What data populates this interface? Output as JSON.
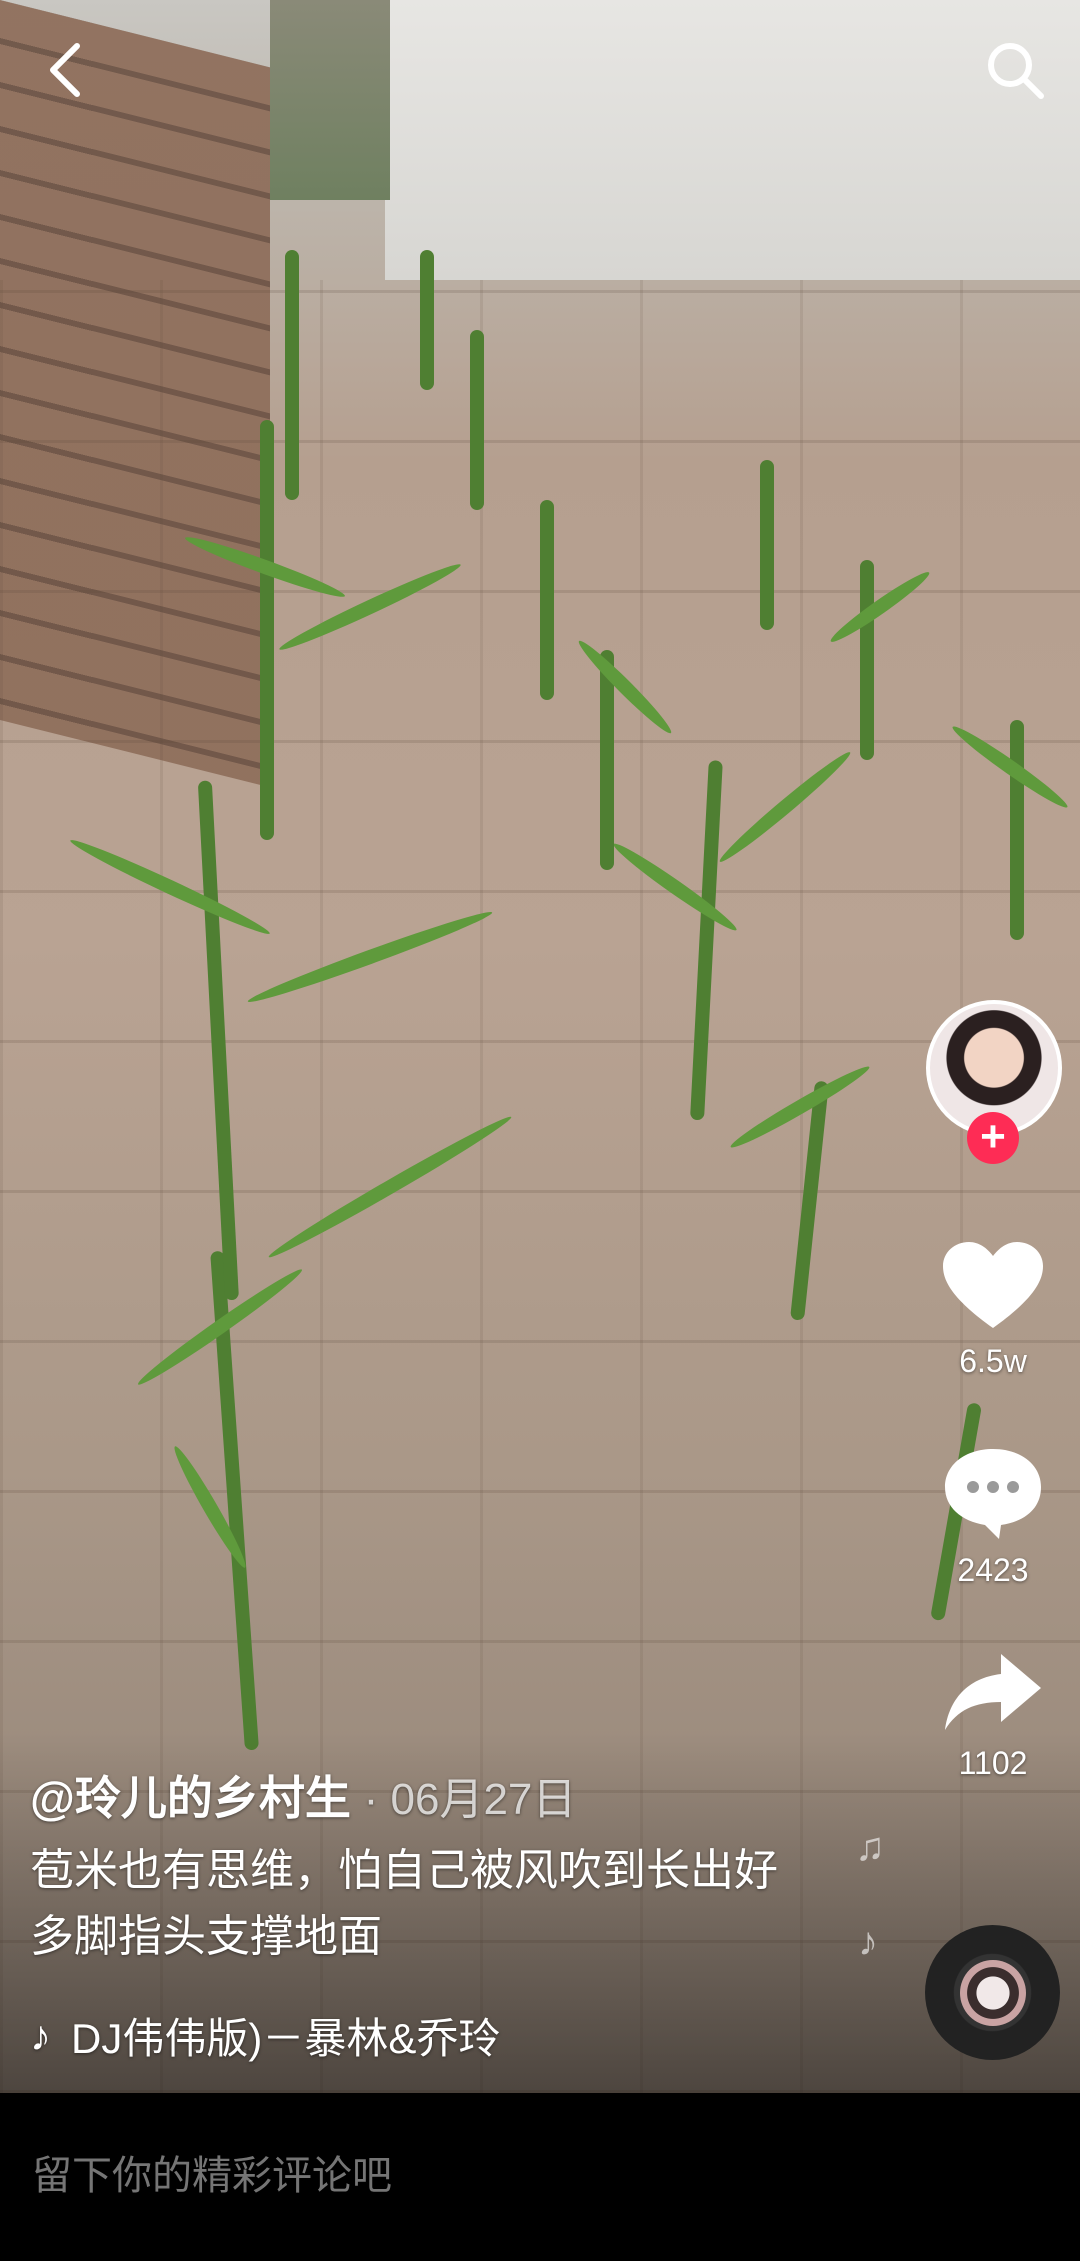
{
  "author": {
    "handle": "@玲儿的乡村生",
    "date": "· 06月27日"
  },
  "caption": {
    "text": "苞米也有思维，怕自己被风吹到长出好多脚指头支撑地面"
  },
  "music": {
    "title": "DJ伟伟版)－暴林&乔玲"
  },
  "actions": {
    "likes": "6.5w",
    "comments": "2423",
    "shares": "1102"
  },
  "comment_bar": {
    "placeholder": "留下你的精彩评论吧"
  },
  "icons": {
    "back": "back-arrow-icon",
    "search": "search-icon",
    "like": "heart-icon",
    "comment": "comment-bubble-icon",
    "share": "share-arrow-icon",
    "follow": "plus-icon",
    "music": "music-note-icon"
  },
  "colors": {
    "accent": "#fe2c55",
    "background": "#000000"
  }
}
